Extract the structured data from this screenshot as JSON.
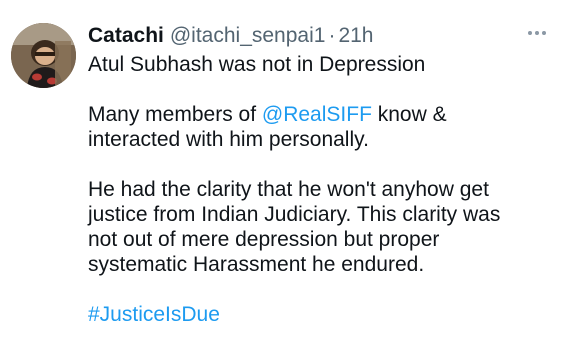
{
  "tweet": {
    "author": {
      "display_name": "Catachi",
      "handle": "@itachi_senpai1",
      "separator": "·",
      "time": "21h",
      "avatar_icon": "profile-avatar"
    },
    "more_icon": "more-options-icon",
    "line1": "Atul Subhash was not in Depression",
    "para2": {
      "before_mention": "Many members of ",
      "mention": "@RealSIFF",
      "after_mention": " know &",
      "line2": "interacted with him personally."
    },
    "para3": {
      "line1": "He had the clarity that he won't anyhow get",
      "line2": "justice from Indian Judiciary. This clarity was",
      "line3": "not out of mere depression but proper",
      "line4": "systematic Harassment he endured."
    },
    "hashtag": "#JusticeIsDue",
    "colors": {
      "link": "#1d9bf0",
      "text": "#0f1419",
      "secondary": "#536471"
    }
  }
}
